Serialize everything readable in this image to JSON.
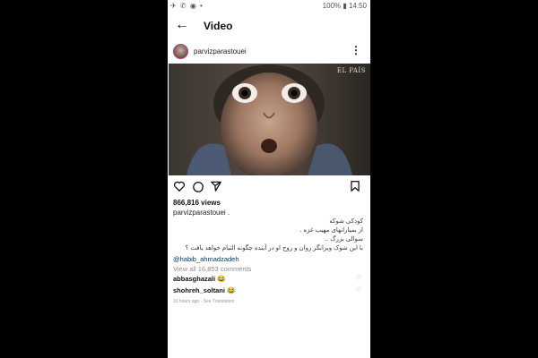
{
  "status_bar": {
    "left_icons": "✈ ✆ ◉ •",
    "right_text": "100% ▮ 14:50"
  },
  "header": {
    "back_icon": "arrow-left-icon",
    "title": "Video"
  },
  "post": {
    "username": "parvizparastouei",
    "watermark": "EL PAÍS",
    "views": "866,816 views",
    "caption_user": "parvizparastouei .",
    "caption_lines": [
      "کودکی شوکه",
      "از بمبارانهای مهیب غزه .",
      "سوالی بزرگ ..",
      "با این شوک ویرانگر روان و روح او در آینده چگونه التیام خواهد یافت ؟"
    ],
    "mention": "@habib_ahmadzadeh",
    "view_all_comments": "View all 16,853 comments",
    "comments": [
      {
        "user": "abbasghazali",
        "text": "😂"
      },
      {
        "user": "shohreh_soltani",
        "text": "😂"
      }
    ],
    "time": "16 hours ago · See Translation"
  },
  "icons": {
    "like": "heart-icon",
    "comment": "comment-icon",
    "share": "paper-plane-icon",
    "save": "bookmark-icon"
  },
  "colors": {
    "background": "#000000",
    "link": "#00376b",
    "muted": "#8e8e8e"
  }
}
